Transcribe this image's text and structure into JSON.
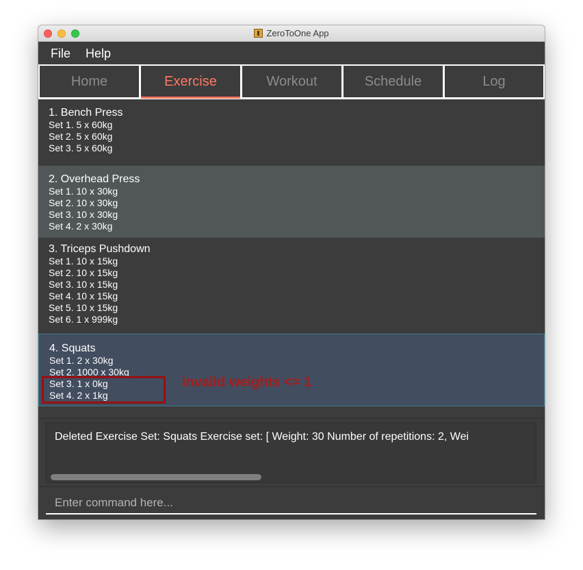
{
  "window": {
    "title": "ZeroToOne App",
    "buttons": [
      "close",
      "minimize",
      "maximize"
    ]
  },
  "menu": {
    "items": [
      {
        "label": "File"
      },
      {
        "label": "Help"
      }
    ]
  },
  "tabs": [
    {
      "label": "Home"
    },
    {
      "label": "Exercise"
    },
    {
      "label": "Workout"
    },
    {
      "label": "Schedule"
    },
    {
      "label": "Log"
    }
  ],
  "active_tab": "Exercise",
  "exercises": [
    {
      "title": "1.  Bench Press",
      "sets": [
        "Set 1. 5 x 60kg",
        "Set 2. 5 x 60kg",
        "Set 3. 5 x 60kg"
      ]
    },
    {
      "title": "2.  Overhead Press",
      "sets": [
        "Set 1. 10 x 30kg",
        "Set 2. 10 x 30kg",
        "Set 3. 10 x 30kg",
        "Set 4. 2 x 30kg"
      ]
    },
    {
      "title": "3.  Triceps Pushdown",
      "sets": [
        "Set 1. 10 x 15kg",
        "Set 2. 10 x 15kg",
        "Set 3. 10 x 15kg",
        "Set 4. 10 x 15kg",
        "Set 5. 10 x 15kg",
        "Set 6. 1 x 999kg"
      ]
    },
    {
      "title": "4.  Squats",
      "sets": [
        "Set 1. 2 x 30kg",
        "Set 2. 1000 x 30kg",
        "Set 3. 1 x 0kg",
        "Set 4. 2 x 1kg"
      ]
    }
  ],
  "annotation": {
    "text": "invalid weights <= 1"
  },
  "result": {
    "text": "Deleted Exercise Set: Squats Exercise set: [ Weight: 30 Number of repetitions: 2,  Wei"
  },
  "command": {
    "placeholder": "Enter command here...",
    "value": ""
  },
  "colors": {
    "background": "#3c3c3c",
    "active_tab": "#ff7863",
    "inactive_tab_text": "#8c8c8c",
    "alt_row": "#515658",
    "selected_row": "#424d5f",
    "annotation": "#a81c1c"
  }
}
